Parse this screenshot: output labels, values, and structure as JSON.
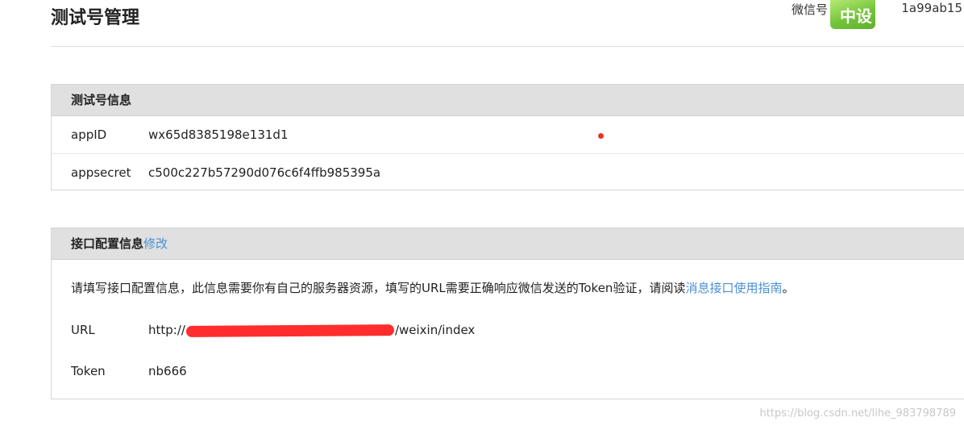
{
  "header": {
    "title": "测试号管理",
    "account_label": "微信号",
    "account_value": "1a99ab15",
    "avatar_text": "中设"
  },
  "test_account": {
    "heading": "测试号信息",
    "rows": [
      {
        "key": "appID",
        "value": "wx65d8385198e131d1"
      },
      {
        "key": "appsecret",
        "value": "c500c227b57290d076c6f4ffb985395a"
      }
    ]
  },
  "interface_config": {
    "heading": "接口配置信息",
    "edit_link": "修改",
    "note_text": "请填写接口配置信息，此信息需要你有自己的服务器资源，填写的URL需要正确响应微信发送的Token验证，请阅读",
    "note_link": "消息接口使用指南",
    "note_end": "。",
    "url_label": "URL",
    "url_prefix": "http://",
    "url_suffix": "/weixin/index",
    "token_label": "Token",
    "token_value": "nb666"
  },
  "watermark": "https://blog.csdn.net/lihe_983798789",
  "colors": {
    "link": "#4a90d6",
    "panel_header_bg": "#e0e0e0",
    "redaction": "#ff2d2d"
  }
}
